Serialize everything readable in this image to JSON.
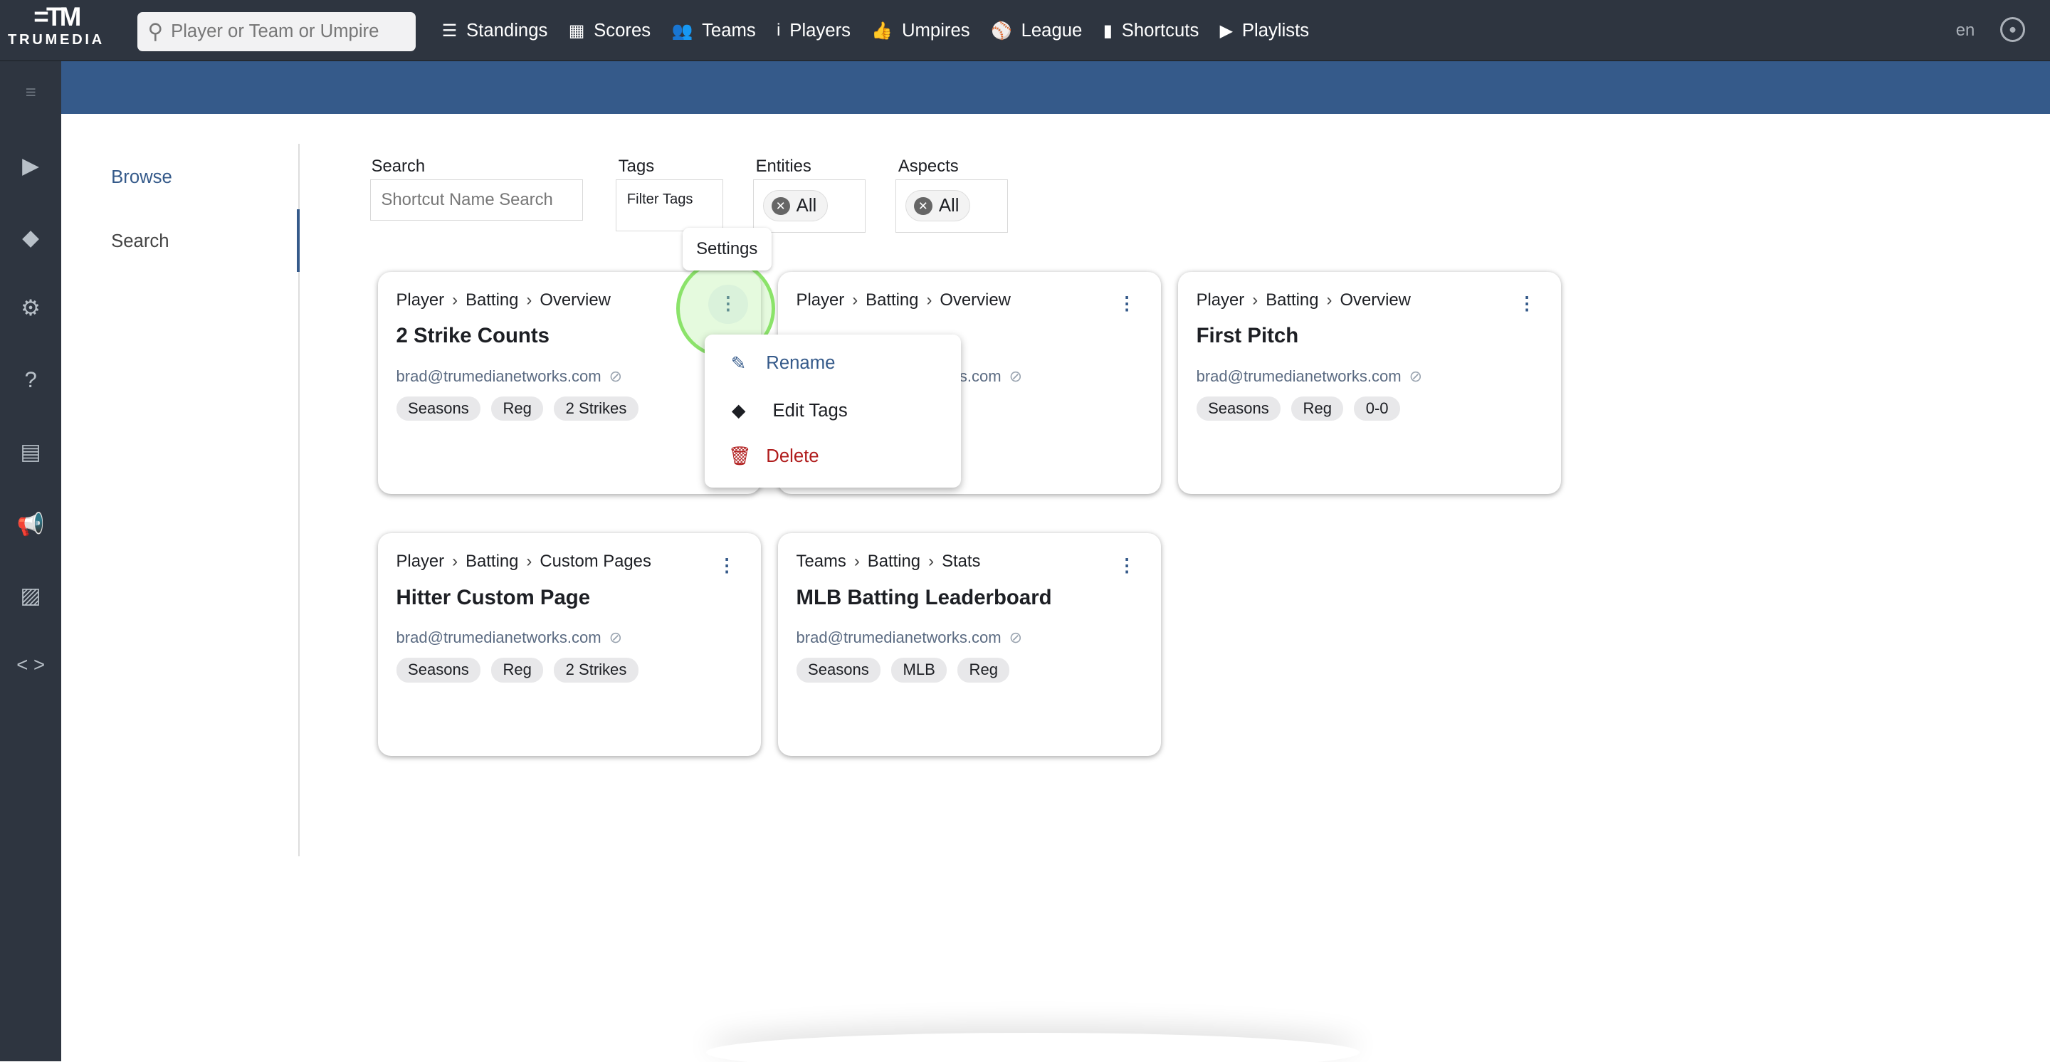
{
  "topnav": {
    "logo_text": "TRUMEDIA",
    "search_placeholder": "Player or Team or Umpire",
    "items": [
      {
        "label": "Standings",
        "icon": "table-icon"
      },
      {
        "label": "Scores",
        "icon": "grid-icon"
      },
      {
        "label": "Teams",
        "icon": "users-icon"
      },
      {
        "label": "Players",
        "icon": "person-icon"
      },
      {
        "label": "Umpires",
        "icon": "thumbs-up-icon"
      },
      {
        "label": "League",
        "icon": "baseballs-icon"
      },
      {
        "label": "Shortcuts",
        "icon": "bookmark-icon"
      },
      {
        "label": "Playlists",
        "icon": "playlist-icon"
      }
    ],
    "language": "en"
  },
  "subnav": {
    "items": [
      {
        "label": "Browse",
        "active_color": "#355a8a"
      },
      {
        "label": "Search"
      }
    ]
  },
  "filters": {
    "search_label": "Search",
    "search_placeholder": "Shortcut Name Search",
    "tags_label": "Tags",
    "tags_placeholder": "Filter Tags",
    "entities_label": "Entities",
    "entities_value": "All",
    "aspects_label": "Aspects",
    "aspects_value": "All"
  },
  "tooltip": "Settings",
  "cards": [
    {
      "crumbs": [
        "Player",
        "Batting",
        "Overview"
      ],
      "title": "2 Strike Counts",
      "email": "brad@trumedianetworks.com",
      "tags": [
        "Seasons",
        "Reg",
        "2 Strikes"
      ]
    },
    {
      "crumbs": [
        "Player",
        "Batting",
        "Overview"
      ],
      "title": "",
      "email": "brad@trumedianetworks.com",
      "tags": []
    },
    {
      "crumbs": [
        "Player",
        "Batting",
        "Overview"
      ],
      "title": "First Pitch",
      "email": "brad@trumedianetworks.com",
      "tags": [
        "Seasons",
        "Reg",
        "0-0"
      ]
    },
    {
      "crumbs": [
        "Player",
        "Batting",
        "Custom Pages"
      ],
      "title": "Hitter Custom Page",
      "email": "brad@trumedianetworks.com",
      "tags": [
        "Seasons",
        "Reg",
        "2 Strikes"
      ]
    },
    {
      "crumbs": [
        "Teams",
        "Batting",
        "Stats"
      ],
      "title": "MLB Batting Leaderboard",
      "email": "brad@trumedianetworks.com",
      "tags": [
        "Seasons",
        "MLB",
        "Reg"
      ]
    }
  ],
  "menu": {
    "items": [
      {
        "label": "Rename",
        "icon": "pencil-icon",
        "color": "#355a8a"
      },
      {
        "label": "Edit Tags",
        "icon": "tags-icon",
        "color": "#1d1f24"
      },
      {
        "label": "Delete",
        "icon": "trash-icon",
        "color": "#b01c1c"
      }
    ]
  }
}
